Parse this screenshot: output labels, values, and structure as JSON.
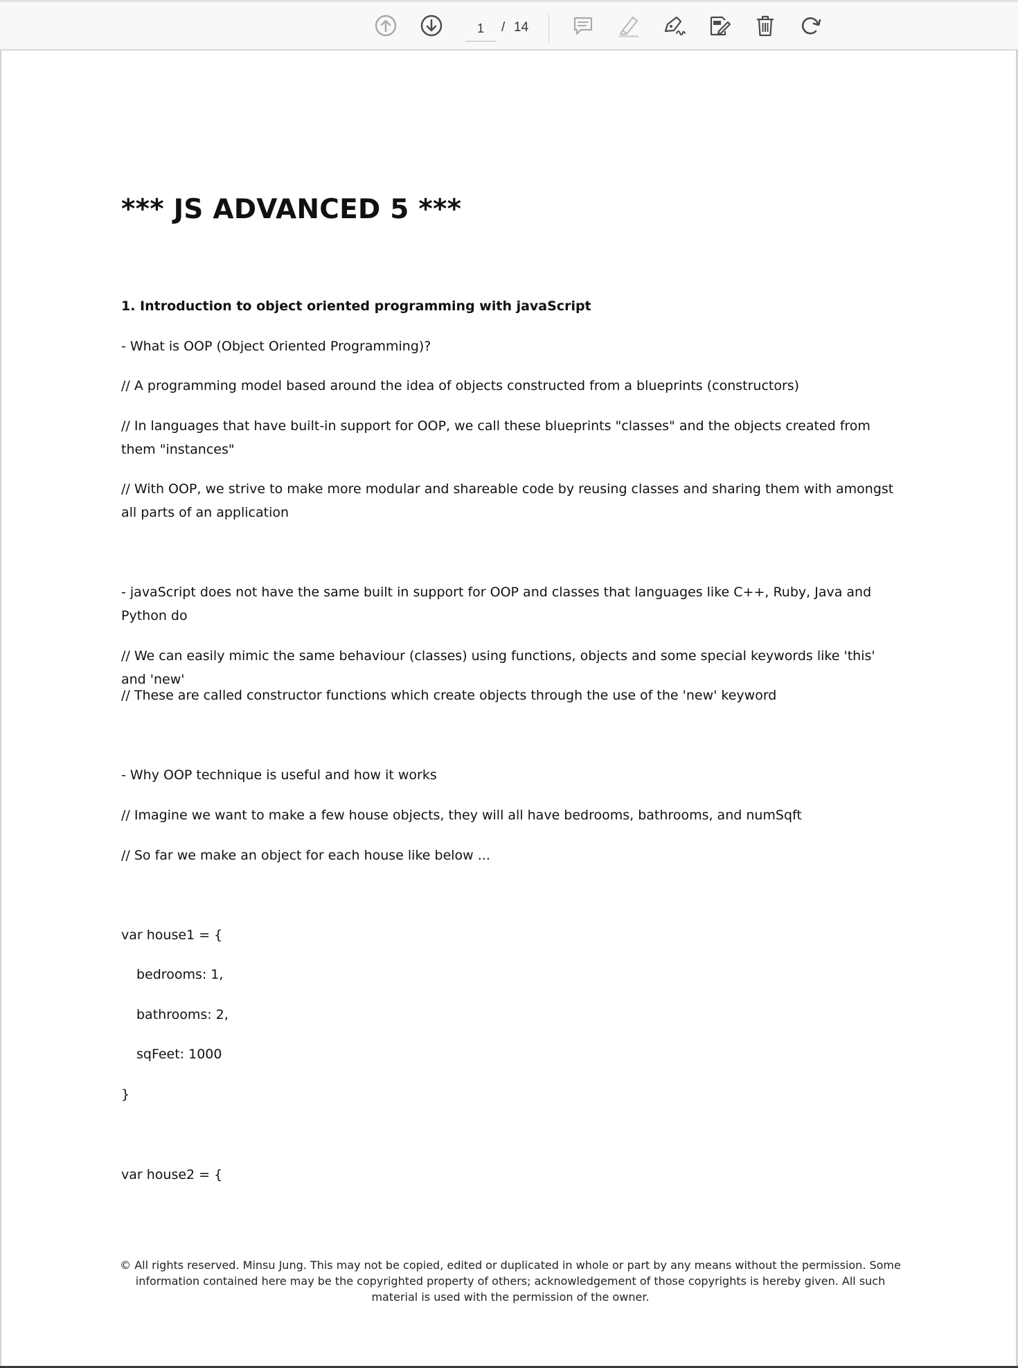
{
  "toolbar": {
    "current_page": "1",
    "page_separator": "/",
    "total_pages": "14",
    "icons": {
      "previous": "arrow-up-circle-icon",
      "next": "arrow-down-circle-icon",
      "comment": "comment-icon",
      "highlight": "highlighter-icon",
      "draw": "pen-sign-icon",
      "edit": "edit-document-icon",
      "delete": "trash-icon",
      "rotate": "rotate-icon"
    }
  },
  "document": {
    "title": "*** JS ADVANCED 5 ***",
    "lines": [
      "1. Introduction to object oriented programming with javaScript",
      "- What is OOP (Object Oriented Programming)?",
      "// A programming model based around the idea of objects constructed from a blueprints (constructors)",
      "// In languages that have built-in support for OOP, we call these blueprints \"classes\" and the objects created from them \"instances\"",
      "// With OOP, we strive to make more modular and shareable code by reusing classes and sharing them with amongst all parts of an application",
      "- javaScript does not have the same built in support for OOP and classes that languages like C++, Ruby, Java and Python do",
      "// We can easily mimic the same behaviour (classes) using functions, objects and some special keywords like 'this' and 'new'",
      "// These are called constructor functions which create objects through the use of the 'new' keyword",
      "- Why OOP technique is useful and how it works",
      "// Imagine we want to make a few house objects, they will all have bedrooms, bathrooms, and numSqft",
      "// So far we make an object for each house like below ...",
      "var house1 = {",
      "bedrooms: 1,",
      "bathrooms: 2,",
      "sqFeet: 1000",
      "}",
      "var house2 = {"
    ],
    "footer": "© All rights reserved. Minsu Jung. This may not be copied, edited or duplicated in whole or part by any means without the permission. Some information contained here may be the copyrighted property of others; acknowledgement of those copyrights is hereby given. All such material is used with the permission of the owner."
  }
}
